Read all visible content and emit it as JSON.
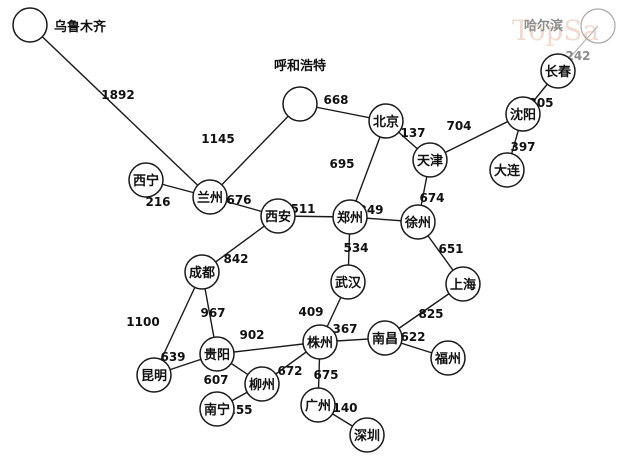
{
  "watermark_text": "TopSa",
  "nodes": [
    {
      "id": "wulumuqi",
      "label": "乌鲁木齐",
      "ring": true
    },
    {
      "id": "huhehaote",
      "label": "呼和浩特",
      "ring": true
    },
    {
      "id": "haerbin",
      "label": "哈尔滨",
      "ring": true,
      "faded": true
    },
    {
      "id": "changchun",
      "label": "长春"
    },
    {
      "id": "shenyang",
      "label": "沈阳"
    },
    {
      "id": "dalian",
      "label": "大连"
    },
    {
      "id": "beijing",
      "label": "北京"
    },
    {
      "id": "tianjin",
      "label": "天津"
    },
    {
      "id": "xining",
      "label": "西宁"
    },
    {
      "id": "lanzhou",
      "label": "兰州"
    },
    {
      "id": "xian",
      "label": "西安"
    },
    {
      "id": "zhengzhou",
      "label": "郑州"
    },
    {
      "id": "xuzhou",
      "label": "徐州"
    },
    {
      "id": "chengdu",
      "label": "成都"
    },
    {
      "id": "wuhan",
      "label": "武汉"
    },
    {
      "id": "shanghai",
      "label": "上海"
    },
    {
      "id": "kunming",
      "label": "昆明"
    },
    {
      "id": "guiyang",
      "label": "贵阳"
    },
    {
      "id": "zhuzhou",
      "label": "株州"
    },
    {
      "id": "nanchang",
      "label": "南昌"
    },
    {
      "id": "fuzhou",
      "label": "福州"
    },
    {
      "id": "liuzhou",
      "label": "柳州"
    },
    {
      "id": "nanning",
      "label": "南宁"
    },
    {
      "id": "guangzhou",
      "label": "广州"
    },
    {
      "id": "shenzhen",
      "label": "深圳"
    }
  ],
  "edges": [
    {
      "from": "wulumuqi",
      "to": "lanzhou",
      "label": "1892"
    },
    {
      "from": "xining",
      "to": "lanzhou",
      "label": "216"
    },
    {
      "from": "lanzhou",
      "to": "huhehaote",
      "label": "1145"
    },
    {
      "from": "huhehaote",
      "to": "beijing",
      "label": "668"
    },
    {
      "from": "lanzhou",
      "to": "xian",
      "label": "676"
    },
    {
      "from": "xian",
      "to": "zhengzhou",
      "label": "511"
    },
    {
      "from": "zhengzhou",
      "to": "beijing",
      "label": "695"
    },
    {
      "from": "beijing",
      "to": "tianjin",
      "label": "137"
    },
    {
      "from": "tianjin",
      "to": "shenyang",
      "label": "704"
    },
    {
      "from": "shenyang",
      "to": "changchun",
      "label": "305"
    },
    {
      "from": "shenyang",
      "to": "dalian",
      "label": "397"
    },
    {
      "from": "changchun",
      "to": "haerbin",
      "label": "242",
      "faded": true
    },
    {
      "from": "zhengzhou",
      "to": "xuzhou",
      "label": "349"
    },
    {
      "from": "tianjin",
      "to": "xuzhou",
      "label": "674"
    },
    {
      "from": "xuzhou",
      "to": "shanghai",
      "label": "651"
    },
    {
      "from": "zhengzhou",
      "to": "wuhan",
      "label": "534"
    },
    {
      "from": "xian",
      "to": "chengdu",
      "label": "842"
    },
    {
      "from": "chengdu",
      "to": "kunming",
      "label": "1100"
    },
    {
      "from": "chengdu",
      "to": "guiyang",
      "label": "967"
    },
    {
      "from": "kunming",
      "to": "guiyang",
      "label": "639"
    },
    {
      "from": "guiyang",
      "to": "zhuzhou",
      "label": "902"
    },
    {
      "from": "wuhan",
      "to": "zhuzhou",
      "label": "409"
    },
    {
      "from": "zhuzhou",
      "to": "nanchang",
      "label": "367"
    },
    {
      "from": "nanchang",
      "to": "shanghai",
      "label": "825"
    },
    {
      "from": "nanchang",
      "to": "fuzhou",
      "label": "622"
    },
    {
      "from": "guiyang",
      "to": "liuzhou",
      "label": "607"
    },
    {
      "from": "zhuzhou",
      "to": "liuzhou",
      "label": "672"
    },
    {
      "from": "liuzhou",
      "to": "nanning",
      "label": "255"
    },
    {
      "from": "zhuzhou",
      "to": "guangzhou",
      "label": "675"
    },
    {
      "from": "guangzhou",
      "to": "shenzhen",
      "label": "140"
    }
  ]
}
